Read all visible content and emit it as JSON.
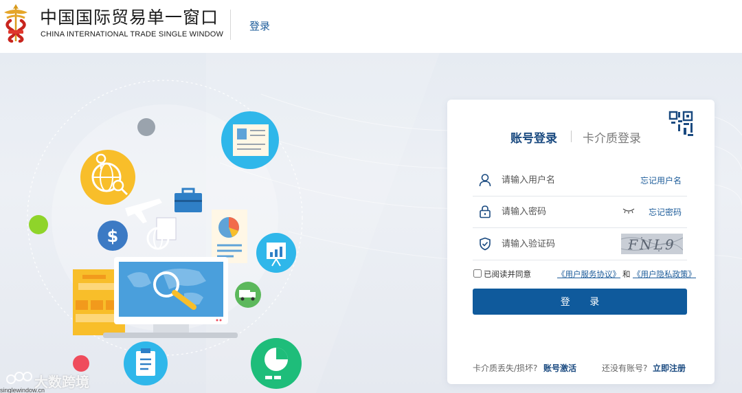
{
  "header": {
    "brand_cn": "中国国际贸易单一窗口",
    "brand_en": "CHINA INTERNATIONAL TRADE SINGLE WINDOW",
    "login_link": "登录"
  },
  "login_card": {
    "tabs": [
      {
        "label": "账号登录",
        "active": true
      },
      {
        "label": "卡介质登录",
        "active": false
      }
    ],
    "username": {
      "placeholder": "请输入用户名",
      "value": "",
      "link": "忘记用户名"
    },
    "password": {
      "placeholder": "请输入密码",
      "value": "",
      "link": "忘记密码"
    },
    "captcha": {
      "placeholder": "请输入验证码",
      "value": "",
      "image_text": "FNL9"
    },
    "agreement": {
      "prefix": "已阅读并同意",
      "service_link": "《用户服务协议》",
      "conjunction": "和",
      "privacy_link": "《用户隐私政策》",
      "checked": false
    },
    "submit_label": "登 录",
    "footer": {
      "card_lost_text": "卡介质丢失/损坏?",
      "card_activate_link": "账号激活",
      "no_account_text": "还没有账号?",
      "register_link": "立即注册"
    }
  },
  "watermark": {
    "text": "大数跨境",
    "url": "singlewindow.cn"
  },
  "colors": {
    "brand_blue": "#0f5a9c",
    "link_blue": "#1d5c9a",
    "tab_active": "#1a4a80",
    "hero_bg": "#e6ebf2"
  },
  "icons": [
    "emblem-logo",
    "qr-code-icon",
    "user-icon",
    "lock-icon",
    "eye-closed-icon",
    "shield-check-icon"
  ]
}
